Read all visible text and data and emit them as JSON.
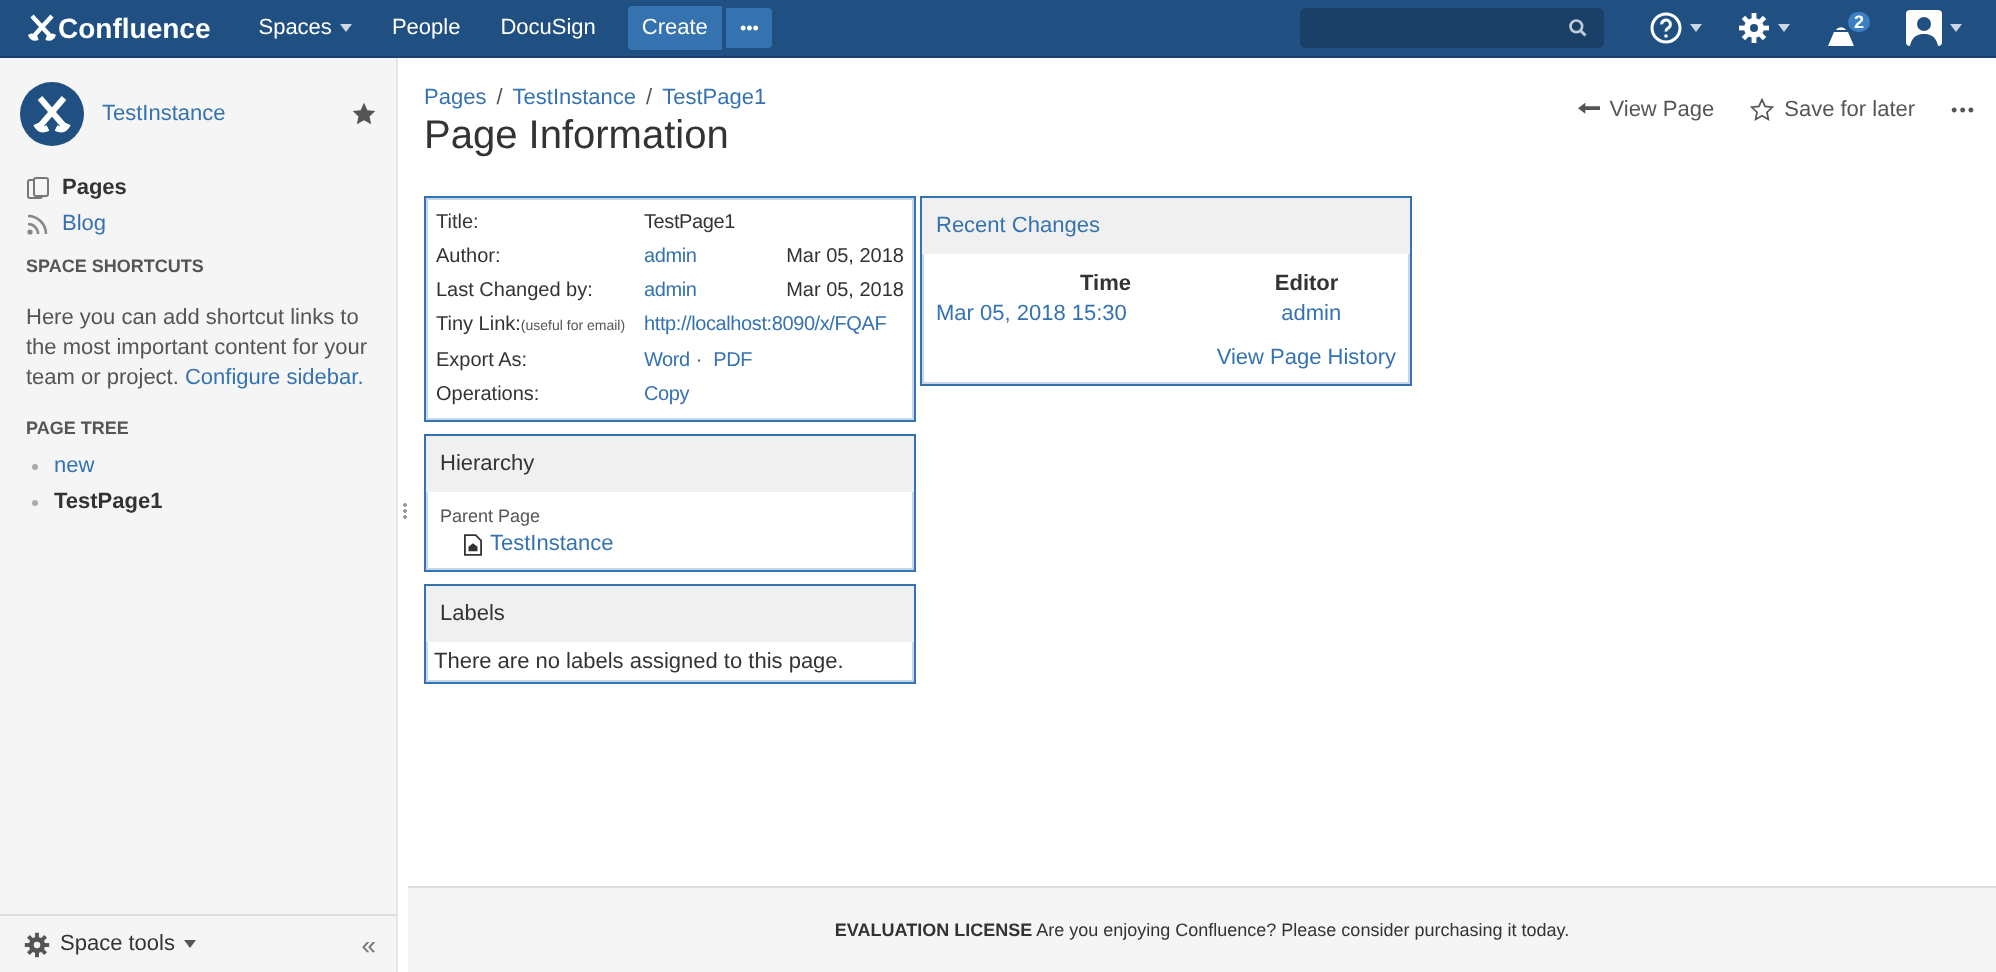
{
  "header": {
    "logo": "Confluence",
    "nav": [
      {
        "label": "Spaces",
        "dropdown": true
      },
      {
        "label": "People",
        "dropdown": false
      },
      {
        "label": "DocuSign",
        "dropdown": false
      }
    ],
    "create": "Create",
    "more": "•••",
    "notifications": "2"
  },
  "sidebar": {
    "space_name": "TestInstance",
    "nav": [
      {
        "label": "Pages",
        "kind": "pages",
        "selected": true
      },
      {
        "label": "Blog",
        "kind": "blog",
        "selected": false
      }
    ],
    "shortcuts_heading": "SPACE SHORTCUTS",
    "shortcuts_text": "Here you can add shortcut links to the most important content for your team or project.",
    "shortcuts_link": "Configure sidebar.",
    "tree_heading": "PAGE TREE",
    "tree": [
      {
        "label": "new",
        "selected": false
      },
      {
        "label": "TestPage1",
        "selected": true
      }
    ],
    "space_tools": "Space tools",
    "collapse": "«"
  },
  "breadcrumbs": [
    "Pages",
    "TestInstance",
    "TestPage1"
  ],
  "breadcrumb_separator": "/",
  "title": "Page Information",
  "actions": {
    "view_page": "View Page",
    "save_for_later": "Save for later",
    "more": "•••"
  },
  "info": {
    "rows": [
      {
        "label": "Title:",
        "values": [
          {
            "text": "TestPage1",
            "link": false
          }
        ]
      },
      {
        "label": "Author:",
        "values": [
          {
            "text": "admin",
            "link": true
          }
        ],
        "date": "Mar 05, 2018"
      },
      {
        "label": "Last Changed by:",
        "values": [
          {
            "text": "admin",
            "link": true
          }
        ],
        "date": "Mar 05, 2018"
      },
      {
        "label": "Tiny Link:",
        "note": "(useful for email)",
        "values": [
          {
            "text": "http://localhost:8090/x/FQAF",
            "link": true
          }
        ]
      },
      {
        "label": "Export As:",
        "values": [
          {
            "text": "Word",
            "link": true
          },
          {
            "text": "PDF",
            "link": true
          }
        ],
        "separator": "·"
      },
      {
        "label": "Operations:",
        "values": [
          {
            "text": "Copy",
            "link": true
          }
        ]
      }
    ]
  },
  "hierarchy": {
    "heading": "Hierarchy",
    "parent_label": "Parent Page",
    "parent": "TestInstance"
  },
  "labels": {
    "heading": "Labels",
    "empty": "There are no labels assigned to this page."
  },
  "recent_changes": {
    "heading": "Recent Changes",
    "columns": [
      "Time",
      "Editor"
    ],
    "rows": [
      {
        "time": "Mar 05, 2018 15:30",
        "editor": "admin"
      }
    ],
    "history_link": "View Page History"
  },
  "footer": {
    "license": "**EVALUATION LICENSE** Are you enjoying Confluence? Please consider purchasing it today."
  }
}
